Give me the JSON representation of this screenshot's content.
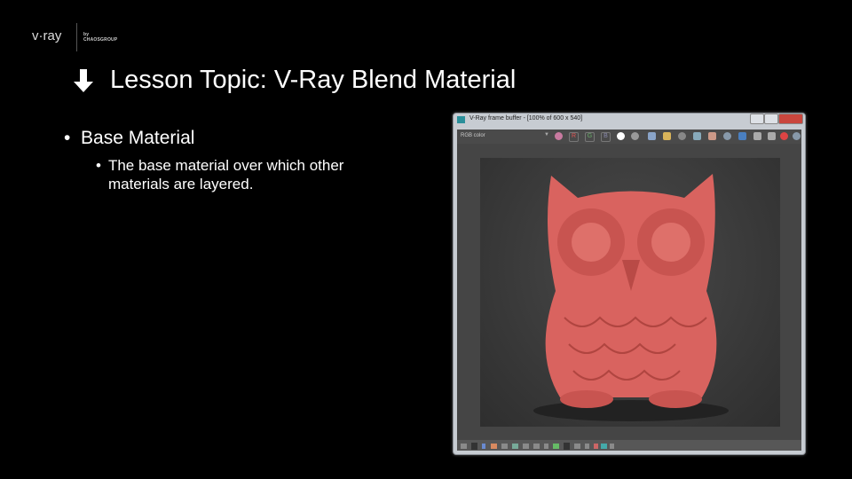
{
  "logo": {
    "brand": "v·ray",
    "by": "by",
    "company": "CHAOSGROUP"
  },
  "slide": {
    "title": "Lesson Topic: V-Ray Blend Material",
    "bullet1": "Base Material",
    "bullet2": "The base material over which other materials are layered.",
    "title_icon": "arrow-down-icon"
  },
  "vfb": {
    "window_title": "V-Ray frame buffer - [100% of 600 x 540]",
    "channel": "RGB color",
    "r": "R",
    "g": "G",
    "b": "B",
    "min": "–",
    "max": "□",
    "close": "x",
    "accent": "#d9635f"
  }
}
